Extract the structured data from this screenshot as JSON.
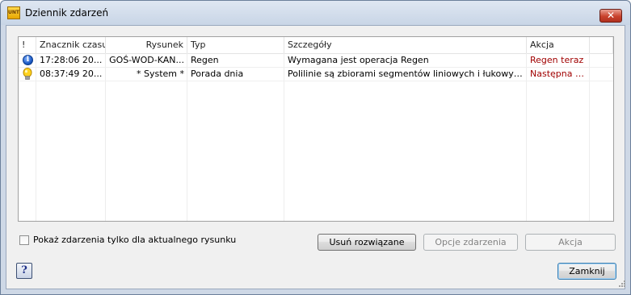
{
  "window": {
    "title": "Dziennik zdarzeń",
    "app_icon_text": "UNT",
    "close_glyph": "✕"
  },
  "table": {
    "columns": {
      "excl": "!",
      "time": "Znacznik czasu",
      "drawing": "Rysunek",
      "type": "Typ",
      "details": "Szczegóły",
      "action": "Akcja"
    },
    "rows": [
      {
        "icon": "info-icon",
        "time": "17:28:06 20...",
        "drawing": "GOŚ-WOD-KAN...",
        "type": "Regen",
        "details": "Wymagana jest operacja Regen",
        "action": "Regen teraz"
      },
      {
        "icon": "lightbulb-icon",
        "time": "08:37:49 20...",
        "drawing": "* System *",
        "type": "Porada dnia",
        "details": "Polilinie są zbiorami segmentów liniowych i łukowych, trak...",
        "action": "Następna p..."
      }
    ]
  },
  "filter": {
    "checkbox_label": "Pokaż zdarzenia tylko dla aktualnego rysunku",
    "checked": false
  },
  "buttons": {
    "remove_resolved": "Usuń rozwiązane",
    "event_options": "Opcje zdarzenia",
    "action": "Akcja",
    "close": "Zamknij",
    "help": "?"
  },
  "colors": {
    "action_link": "#a00000",
    "close_button": "#c9422d",
    "info_icon": "#1e5bc6"
  }
}
